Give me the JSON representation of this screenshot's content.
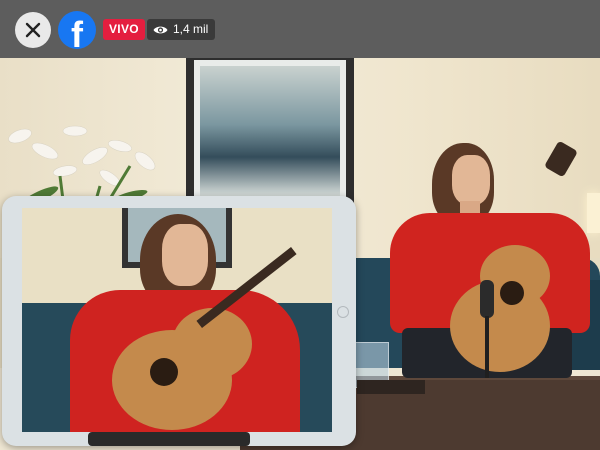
{
  "topbar": {
    "close_icon": "close-icon",
    "logo_icon": "facebook-logo-icon",
    "logo_letter": "f",
    "live_label": "VIVO",
    "viewers_icon": "eye-icon",
    "viewers_count": "1,4 mil"
  },
  "colors": {
    "topbar_bg": "#5d5d5d",
    "facebook_blue": "#1877f2",
    "live_red": "#e41e3f"
  }
}
